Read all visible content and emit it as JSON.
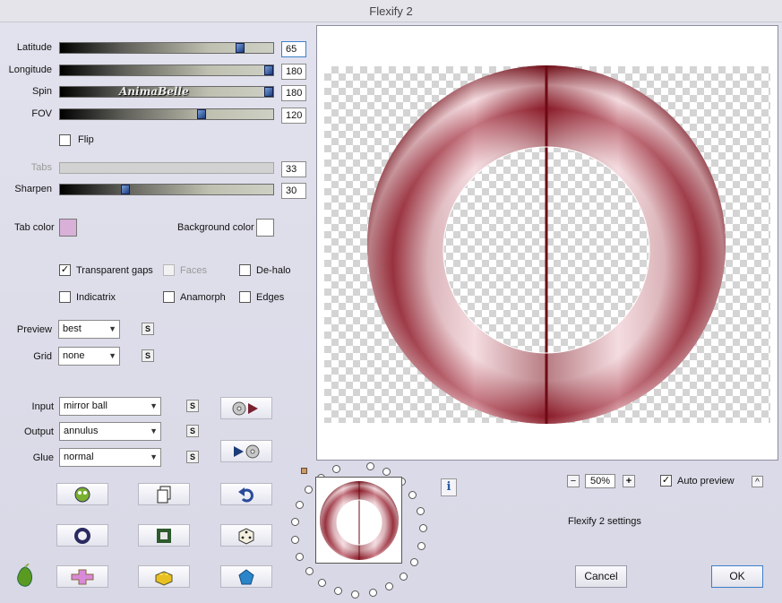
{
  "window": {
    "title": "Flexify 2"
  },
  "sliders": [
    {
      "label": "Latitude",
      "value": "65",
      "level": 0.86
    },
    {
      "label": "Longitude",
      "value": "180",
      "level": 1.0
    },
    {
      "label": "Spin",
      "value": "180",
      "level": 1.0
    },
    {
      "label": "FOV",
      "value": "120",
      "level": 0.67
    },
    {
      "label": "Tabs",
      "value": "33",
      "level": 0.0
    },
    {
      "label": "Sharpen",
      "value": "30",
      "level": 0.3
    }
  ],
  "watermark": "AnimaBelle",
  "flip": {
    "label": "Flip",
    "checked": false
  },
  "tab_color": {
    "label": "Tab color",
    "color": "#d8b0d8"
  },
  "background_color": {
    "label": "Background color",
    "color": "#ffffff"
  },
  "options": {
    "transparent_gaps": {
      "label": "Transparent gaps",
      "checked": true
    },
    "faces": {
      "label": "Faces",
      "checked": false
    },
    "de_halo": {
      "label": "De-halo",
      "checked": false
    },
    "indicatrix": {
      "label": "Indicatrix",
      "checked": false
    },
    "anamorph": {
      "label": "Anamorph",
      "checked": false
    },
    "edges": {
      "label": "Edges",
      "checked": false
    }
  },
  "preview": {
    "label": "Preview",
    "value": "best"
  },
  "grid": {
    "label": "Grid",
    "value": "none"
  },
  "input": {
    "label": "Input",
    "value": "mirror ball"
  },
  "output": {
    "label": "Output",
    "value": "annulus"
  },
  "glue": {
    "label": "Glue",
    "value": "normal"
  },
  "s_label": "S",
  "zoom": {
    "value": "50%",
    "minus": "−",
    "plus": "+"
  },
  "auto_preview": {
    "label": "Auto preview",
    "checked": true,
    "button": "^"
  },
  "settings_label": "Flexify 2 settings",
  "cancel_label": "Cancel",
  "ok_label": "OK",
  "info_label": "i",
  "colors": {
    "ring_dark": "#6e0a14",
    "ring_mid": "#a02838",
    "ring_light": "#f4dce0"
  }
}
